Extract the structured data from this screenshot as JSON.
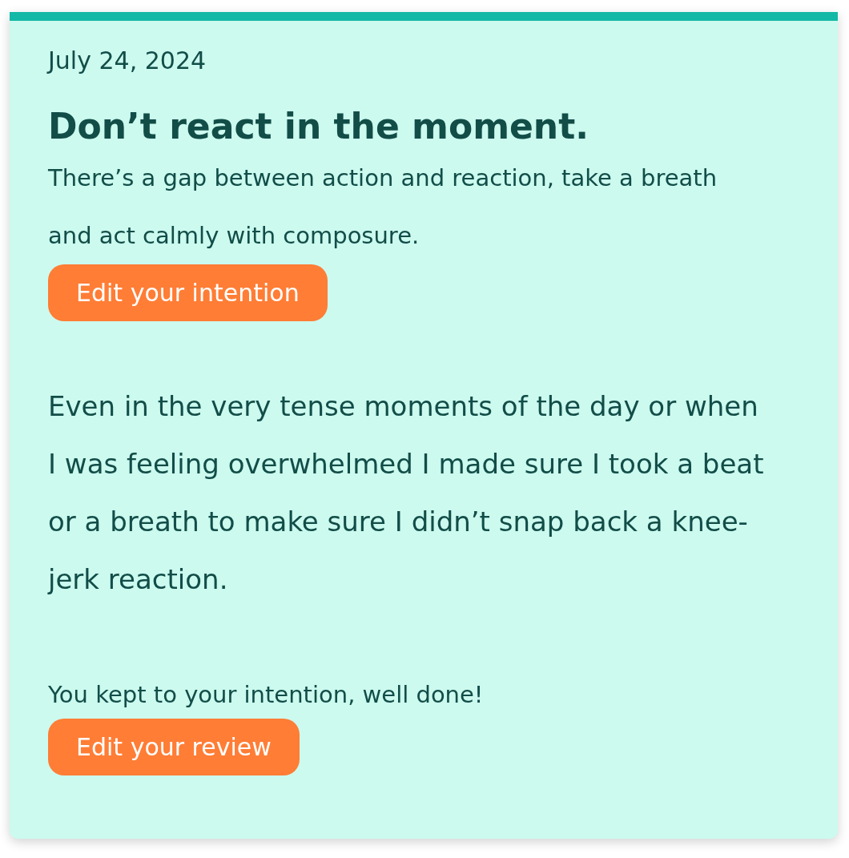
{
  "entry": {
    "date": "July 24, 2024",
    "intention": {
      "title": "Don’t react in the moment.",
      "description": "There’s a gap between action and reaction, take a breath and act calmly with composure.",
      "button": "Edit your intention"
    },
    "reflection": "Even in the very tense moments of the day or when I was feeling overwhelmed I made sure I took a beat or a breath to make sure I didn’t snap back a knee-jerk reaction.",
    "review": {
      "message": "You kept to your intention, well done!",
      "button": "Edit your review"
    }
  }
}
